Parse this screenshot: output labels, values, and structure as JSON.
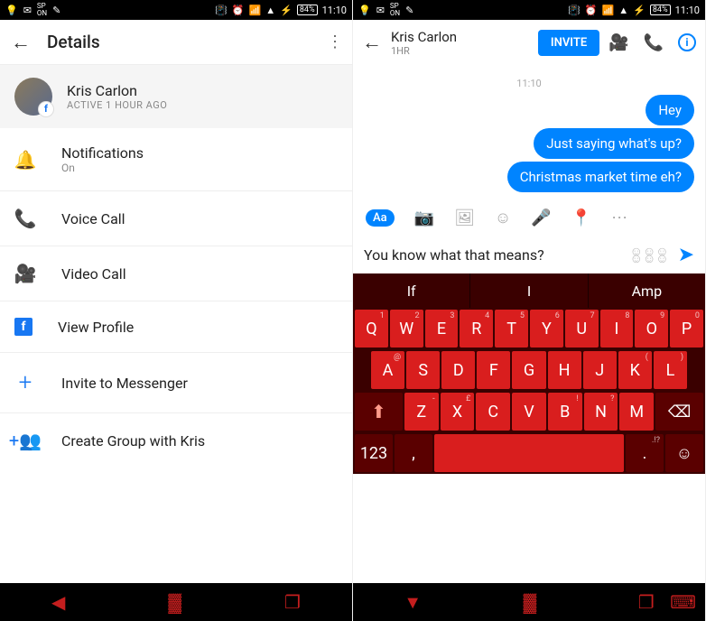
{
  "statusbar": {
    "battery": "84%",
    "time": "11:10"
  },
  "left": {
    "header": {
      "title": "Details"
    },
    "profile": {
      "name": "Kris Carlon",
      "status": "ACTIVE 1 HOUR AGO"
    },
    "menu": {
      "notifications": {
        "label": "Notifications",
        "sub": "On"
      },
      "voice": {
        "label": "Voice Call"
      },
      "video": {
        "label": "Video Call"
      },
      "profile": {
        "label": "View Profile"
      },
      "invite": {
        "label": "Invite to Messenger"
      },
      "group": {
        "label": "Create Group with Kris"
      }
    }
  },
  "right": {
    "header": {
      "name": "Kris Carlon",
      "status": "1HR",
      "invite": "INVITE"
    },
    "timestamp": "11:10",
    "messages": [
      "Hey",
      "Just saying what's up?",
      "Christmas market time eh?"
    ],
    "compose": {
      "aa": "Aa"
    },
    "input": "You know what that means?",
    "suggestions": [
      "If",
      "I",
      "Amp"
    ],
    "rows": {
      "r1": [
        "Q",
        "W",
        "E",
        "R",
        "T",
        "Y",
        "U",
        "I",
        "O",
        "P"
      ],
      "r1sub": [
        "1",
        "2",
        "3",
        "4",
        "5",
        "6",
        "7",
        "8",
        "9",
        "0"
      ],
      "r2": [
        "A",
        "S",
        "D",
        "F",
        "G",
        "H",
        "J",
        "K",
        "L"
      ],
      "r2sub": [
        "@",
        "",
        "",
        "",
        "",
        "",
        "",
        "(",
        ")"
      ],
      "r3": [
        "Z",
        "X",
        "C",
        "V",
        "B",
        "N",
        "M"
      ],
      "r3sub": [
        "-",
        "£",
        "",
        "",
        "!",
        "?",
        ""
      ],
      "r4": {
        "num": "123",
        "comma": ",",
        "dot": "."
      }
    }
  }
}
